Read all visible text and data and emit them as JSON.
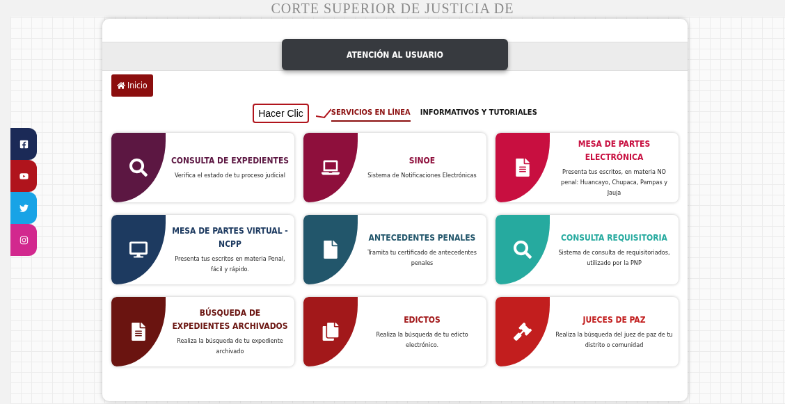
{
  "background_title": "CORTE SUPERIOR DE JUSTICIA DE",
  "social": [
    {
      "kind": "facebook",
      "color": "#1b2a57"
    },
    {
      "kind": "youtube",
      "color": "#b0141c"
    },
    {
      "kind": "twitter",
      "color": "#18a3e6"
    },
    {
      "kind": "instagram",
      "color": "#d2288e"
    }
  ],
  "header": {
    "title": "ATENCIÓN AL USUARIO"
  },
  "home_button": "Inicio",
  "callout": "Hacer Clic",
  "tabs": [
    {
      "label": "SERVICIOS EN LÍNEA",
      "selected": true
    },
    {
      "label": "INFORMATIVOS Y TUTORIALES",
      "selected": false
    }
  ],
  "cards": [
    {
      "kind": "search",
      "color": "#5c1742",
      "title": "CONSULTA DE EXPEDIENTES",
      "description": "Verifica el estado de tu proceso judicial"
    },
    {
      "kind": "laptop",
      "color": "#8e0f3c",
      "title": "SINOE",
      "description": "Sistema de Notificaciones Electrónicas"
    },
    {
      "kind": "document",
      "color": "#c80f40",
      "title": "MESA DE PARTES ELECTRÓNICA",
      "description": "Presenta tus escritos, en materia NO penal: Huancayo, Chupaca, Pampas y Jauja"
    },
    {
      "kind": "monitor",
      "color": "#1d3a60",
      "title": "MESA DE PARTES VIRTUAL - NCPP",
      "description": "Presenta tus escritos en materia Penal, fácil y rápido."
    },
    {
      "kind": "file",
      "color": "#22566b",
      "title": "ANTECEDENTES PENALES",
      "description": "Tramita tu certificado de antecedentes penales"
    },
    {
      "kind": "search",
      "color": "#26aa9f",
      "title": "CONSULTA REQUISITORIA",
      "description": "Sistema de consulta de requisitoriados, utilizado por la PNP"
    },
    {
      "kind": "document",
      "color": "#6a1410",
      "title": "BÚSQUEDA DE EXPEDIENTES ARCHIVADOS",
      "description": "Realiza la búsqueda de tu expediente archivado"
    },
    {
      "kind": "copy",
      "color": "#a2181a",
      "title": "EDICTOS",
      "description": "Realiza la búsqueda de tu edicto electrónico."
    },
    {
      "kind": "gavel",
      "color": "#c21e1e",
      "title": "JUECES DE PAZ",
      "description": "Realiza la búsqueda del juez de paz de tu distrito o comunidad"
    }
  ]
}
